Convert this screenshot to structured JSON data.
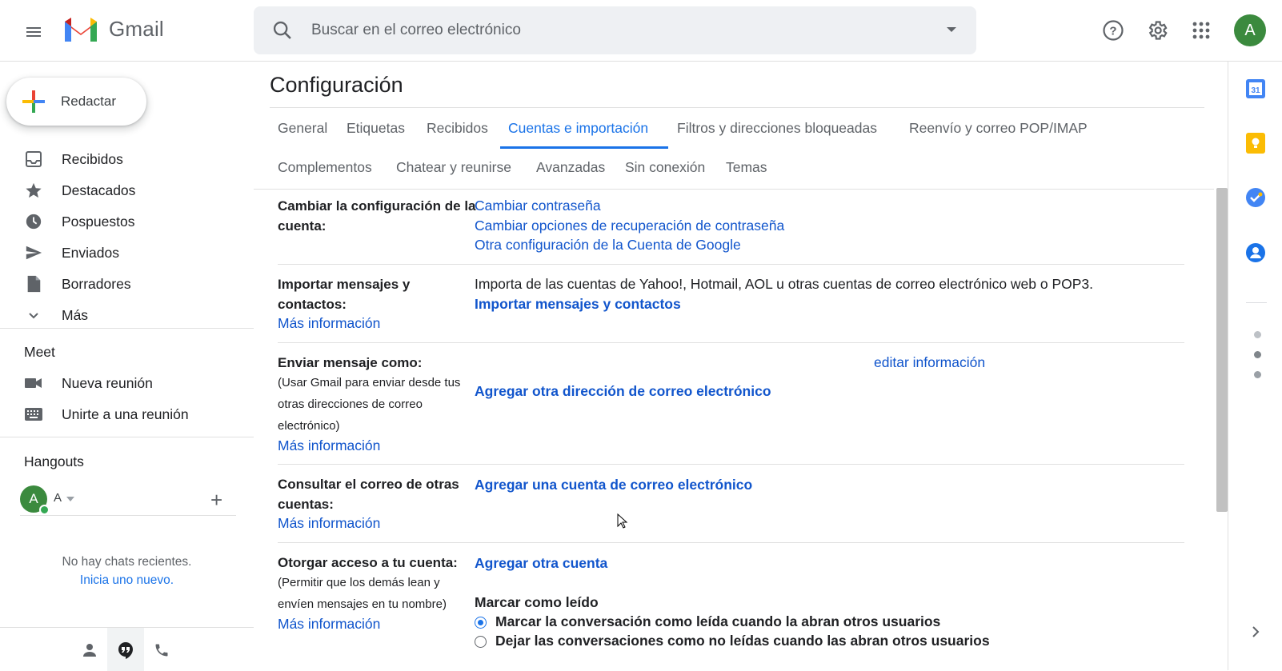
{
  "app": {
    "name": "Gmail"
  },
  "header": {
    "search_placeholder": "Buscar en el correo electrónico",
    "avatar_initial": "A"
  },
  "sidebar": {
    "compose_label": "Redactar",
    "items": [
      {
        "label": "Recibidos",
        "icon": "inbox-icon"
      },
      {
        "label": "Destacados",
        "icon": "star-icon"
      },
      {
        "label": "Pospuestos",
        "icon": "clock-icon"
      },
      {
        "label": "Enviados",
        "icon": "send-icon"
      },
      {
        "label": "Borradores",
        "icon": "draft-icon"
      },
      {
        "label": "Más",
        "icon": "chevron-down-icon"
      }
    ],
    "meet": {
      "title": "Meet",
      "items": [
        {
          "label": "Nueva reunión",
          "icon": "video-icon"
        },
        {
          "label": "Unirte a una reunión",
          "icon": "keyboard-icon"
        }
      ]
    },
    "hangouts": {
      "title": "Hangouts",
      "user_initial": "A",
      "user_name": "A",
      "no_chats": "No hay chats recientes.",
      "start_new": "Inicia uno nuevo."
    }
  },
  "settings": {
    "title": "Configuración",
    "tabs": [
      "General",
      "Etiquetas",
      "Recibidos",
      "Cuentas e importación",
      "Filtros y direcciones bloqueadas",
      "Reenvío y correo POP/IMAP",
      "Complementos",
      "Chatear y reunirse",
      "Avanzadas",
      "Sin conexión",
      "Temas"
    ],
    "active_tab": "Cuentas e importación",
    "sections": {
      "change_account": {
        "label": "Cambiar la configuración de la cuenta:",
        "links": [
          "Cambiar contraseña",
          "Cambiar opciones de recuperación de contraseña",
          "Otra configuración de la Cuenta de Google"
        ]
      },
      "import": {
        "label": "Importar mensajes y contactos:",
        "more": "Más información",
        "description": "Importa de las cuentas de Yahoo!, Hotmail, AOL u otras cuentas de correo electrónico web o POP3.",
        "action": "Importar mensajes y contactos"
      },
      "send_as": {
        "label": "Enviar mensaje como:",
        "sub": "(Usar Gmail para enviar desde tus otras direcciones de correo electrónico)",
        "more": "Más información",
        "edit": "editar información",
        "action": "Agregar otra dirección de correo electrónico"
      },
      "check_mail": {
        "label": "Consultar el correo de otras cuentas:",
        "more": "Más información",
        "action": "Agregar una cuenta de correo electrónico"
      },
      "grant_access": {
        "label": "Otorgar acceso a tu cuenta:",
        "sub": "(Permitir que los demás lean y envíen mensajes en tu nombre)",
        "more": "Más información",
        "action": "Agregar otra cuenta",
        "mark_read_title": "Marcar como leído",
        "options": [
          "Marcar la conversación como leída cuando la abran otros usuarios",
          "Dejar las conversaciones como no leídas cuando las abran otros usuarios"
        ],
        "selected_option": 0
      }
    }
  },
  "colors": {
    "accent": "#1a73e8",
    "link": "#1155cc",
    "avatar": "#3b8a3e"
  }
}
